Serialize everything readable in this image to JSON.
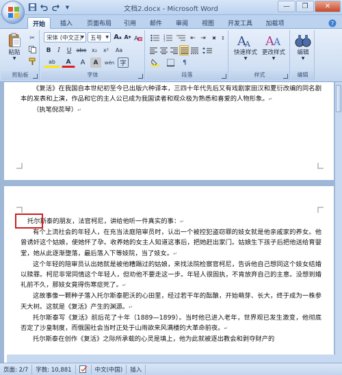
{
  "window": {
    "title": "文档2.docx - Microsoft Word",
    "controls": {
      "minimize": "—",
      "maximize": "❐",
      "close": "✕"
    }
  },
  "qat": {
    "items": [
      "save-icon",
      "undo-icon",
      "redo-icon",
      "customize-icon"
    ]
  },
  "tabs": [
    "开始",
    "插入",
    "页面布局",
    "引用",
    "邮件",
    "审阅",
    "视图",
    "开发工具",
    "加载项"
  ],
  "active_tab": "开始",
  "ribbon": {
    "clipboard": {
      "label": "剪贴板",
      "paste": "粘贴"
    },
    "font": {
      "label": "字体",
      "font_name": "宋体 (中文正)",
      "font_size": "五号",
      "bold": "B",
      "italic": "I",
      "underline": "U",
      "strike": "abe",
      "sub": "x₂",
      "sup": "x²",
      "clear": "Aa",
      "highlight": "ab",
      "color": "A",
      "grow": "A",
      "shrink": "A",
      "phonetic": "wén",
      "border": "A"
    },
    "paragraph": {
      "label": "段落"
    },
    "styles": {
      "label": "样式",
      "quick": "快速样式",
      "change": "更改样式"
    },
    "editing": {
      "label": "编辑",
      "edit": "编辑"
    }
  },
  "document": {
    "page1": [
      "《复活》在我国自本世纪初至今已出版六种译本，三四十年代先后又有戏剧家田汉和夏衍改编的同名剧本的发表和上演，作品和它的主人公已成为我国读者和观众极为熟悉和喜爱的人物形象。",
      "（执笔倪蕊琴）"
    ],
    "page2": [
      "托尔斯泰的朋友，法官柯尼，讲给他听一件真实的事：",
      "有个上流社会的年轻人，在充当法庭陪审员时，认出一个被控犯盗窃罪的妓女就是他亲戚家的养女。他曾诱奸这个姑娘，使她怀了孕。收养她的女主人知道这事后，把她赶出家门。姑娘生下孩子后把他送给育婴堂，她从此逐渐堕落，最后落入下等妓院，当了妓女。",
      "这个年轻的陪审员认出她就是被他糟蹋过的姑娘，来找法院检察官柯尼，告诉他自己想同这个妓女结婚以赎罪。柯尼非常同情这个年轻人，但劝他不要走这一步。年轻人很固执，不肯放弃自己的主意。没想到婚礼前不久，那妓女竟得伤寒症死了。",
      "这故事像一颗种子落入托尔斯泰肥沃的心田里，经过若干年的酝酿，开始萌芽、长大，终于成为一株参天大树。这就是《复活》产生的渊源。",
      "托尔斯泰写《复活》前后花了十年（1889—1899）。当时他已进入老年，世界观已发生激变，他彻底否定了沙皇制度，而俄国社会当时正处于山雨欲来风满楼的大革命前夜。",
      "托尔斯泰在创作《复活》之际所承载的心灵是填上，他为此就被逐出教会和剥夺财产的"
    ]
  },
  "status": {
    "page": "页面: 2/7",
    "words": "字数: 10,881",
    "language": "中文(中国)",
    "mode": "插入"
  }
}
